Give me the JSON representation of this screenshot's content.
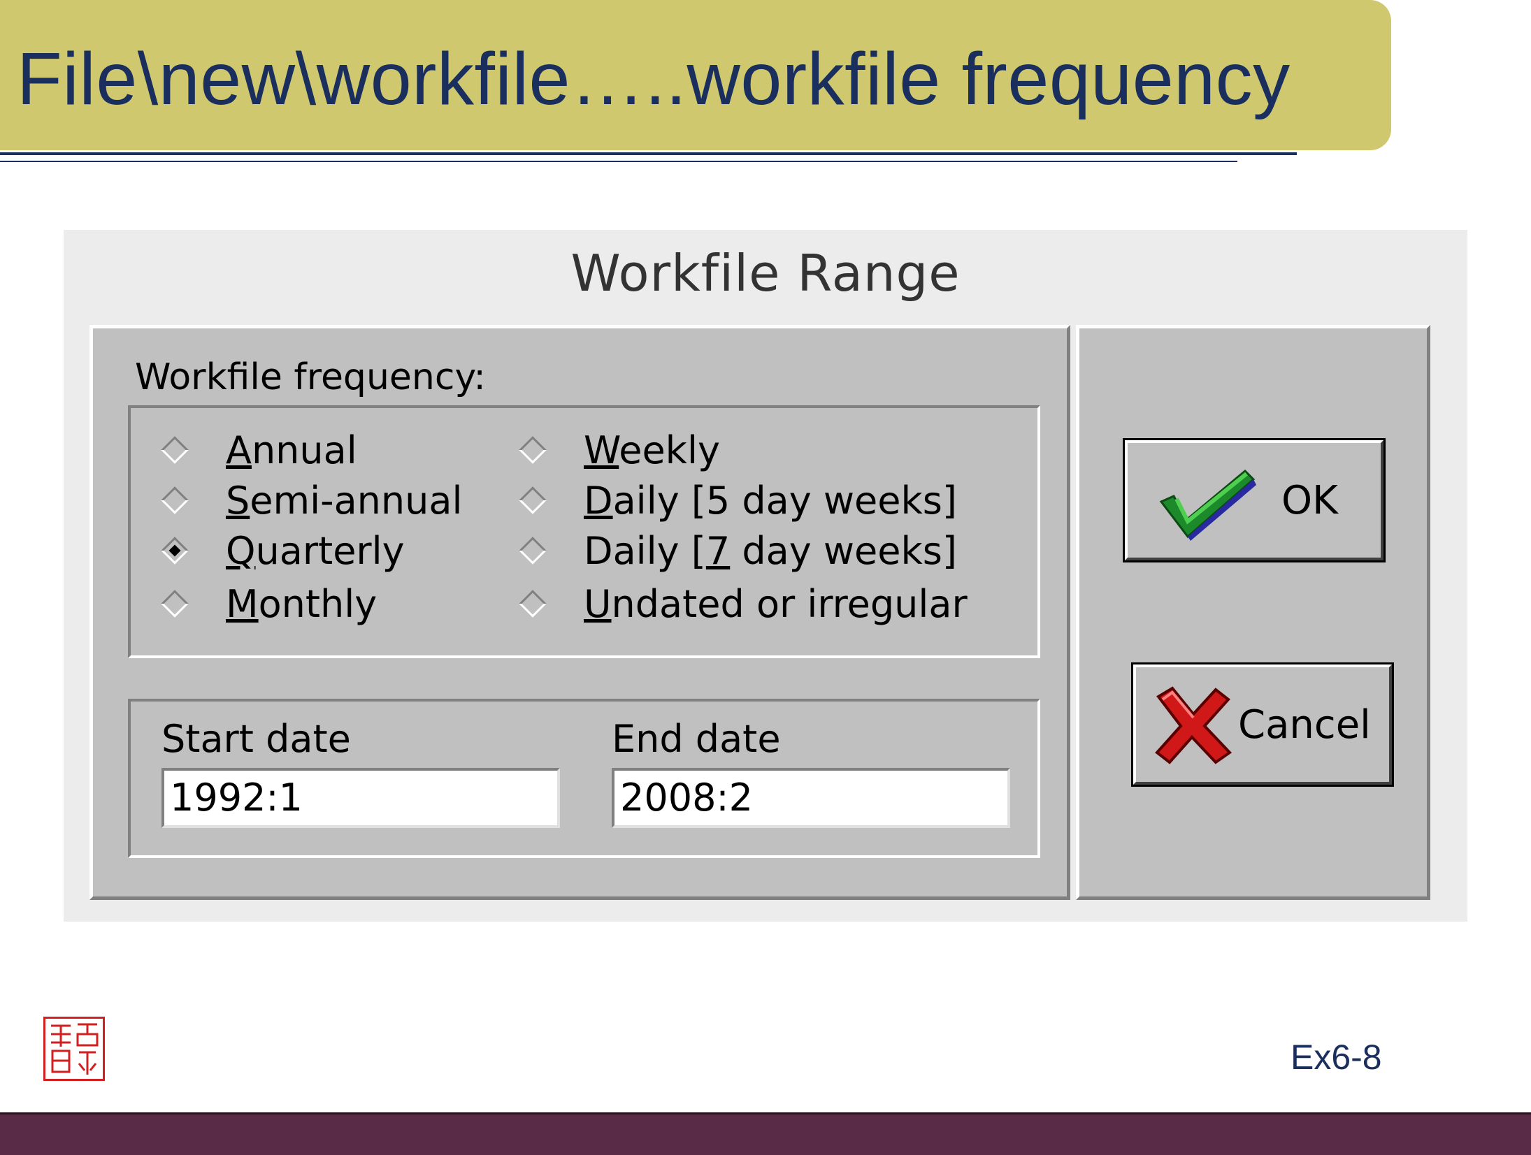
{
  "slide": {
    "title": "File\\new\\workfile…..workfile frequency",
    "slide_number": "Ex6-8"
  },
  "dialog": {
    "title": "Workfile Range",
    "frequency_label": "Workfile frequency:",
    "options": [
      {
        "acc": "A",
        "rest": "nnual",
        "checked": false
      },
      {
        "acc": "S",
        "rest": "emi-annual",
        "checked": false
      },
      {
        "acc": "Q",
        "rest": "uarterly",
        "checked": true
      },
      {
        "acc": "M",
        "rest": "onthly",
        "checked": false
      },
      {
        "acc": "W",
        "rest": "eekly",
        "checked": false
      },
      {
        "acc": "D",
        "rest": "aily [5 day weeks]",
        "checked": false
      },
      {
        "pre": "Daily [",
        "acc": "7",
        "rest": " day weeks]",
        "checked": false
      },
      {
        "acc": "U",
        "rest": "ndated or irregular",
        "checked": false
      }
    ],
    "start_label": "Start date",
    "start_value": "1992:1",
    "end_label": "End date",
    "end_value": "2008:2",
    "ok_label": "OK",
    "cancel_label": "Cancel"
  },
  "colors": {
    "title_bar": "#cfc86f",
    "title_text": "#1b2f5e",
    "bottom_bar": "#5a2b47",
    "seal": "#d21f1f"
  },
  "icons": {
    "ok": "checkmark-icon",
    "cancel": "red-x-icon",
    "seal": "seal-stamp-icon"
  }
}
